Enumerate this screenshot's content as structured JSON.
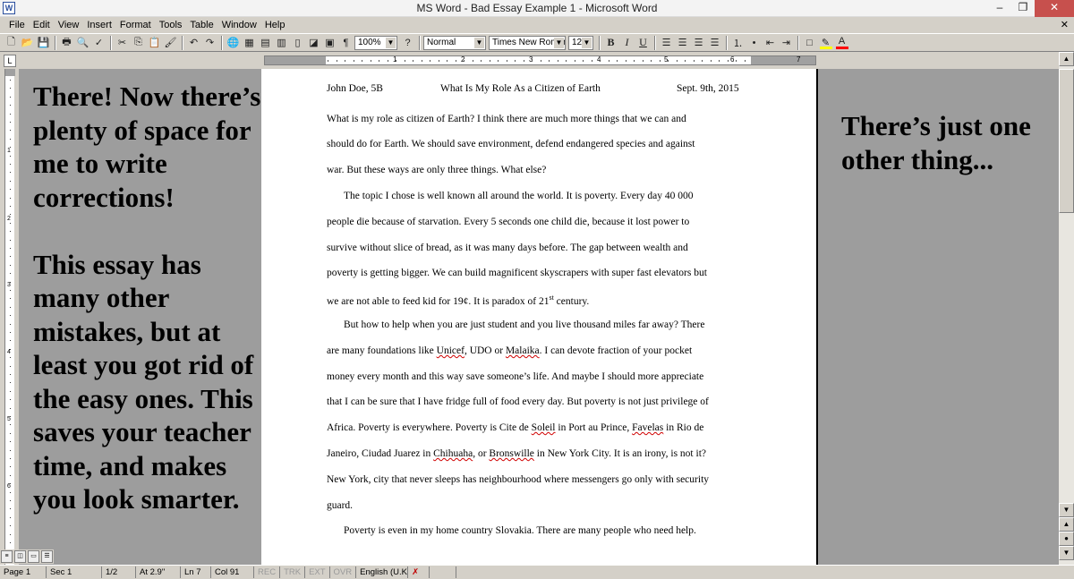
{
  "window": {
    "title": "MS Word - Bad Essay Example 1 - Microsoft Word",
    "app_icon": "W",
    "controls": [
      "–",
      "❐",
      "✕"
    ]
  },
  "menu": {
    "items": [
      "File",
      "Edit",
      "View",
      "Insert",
      "Format",
      "Tools",
      "Table",
      "Window",
      "Help"
    ],
    "doc_close": "✕"
  },
  "toolbar": {
    "zoom": "100%",
    "style": "Normal",
    "font": "Times New Roman",
    "size": "12",
    "bold": "B",
    "italic": "I",
    "underline": "U",
    "highlight_color": "#ffff00",
    "font_color": "#ff0000"
  },
  "ruler": {
    "numbers": [
      "1",
      "2",
      "3",
      "4",
      "5",
      "6",
      "7"
    ],
    "vertical_numbers": [
      "1",
      "2",
      "3",
      "4",
      "5",
      "6"
    ]
  },
  "document": {
    "header": {
      "author": "John Doe, 5B",
      "title": "What Is My Role As a Citizen of Earth",
      "date": "Sept. 9th, 2015"
    },
    "lines": [
      "What is my role as citizen of Earth? I think there are much more things that we can and",
      "should do for Earth. We should save environment, defend endangered species and against",
      "war. But these ways are only three things. What else?",
      "The topic I chose is well known all around the world. It is poverty. Every day 40 000",
      "people die because of starvation. Every 5 seconds one child die, because it lost power to",
      "survive without slice of bread, as it was many days before.  The gap between wealth and",
      "poverty is getting bigger. We can build magnificent skyscrapers with super fast elevators but",
      "we are not able to feed kid for 19¢. It is paradox of 21",
      "But how to help when you are just student and you live thousand miles far away? There",
      "are many foundations like ",
      "money every month and this way save someone’s life. And maybe I should more appreciate",
      "that I can be sure that I have fridge full of food every day.  But poverty is not just privilege of",
      "Africa. Poverty is everywhere.  Poverty is Cite de ",
      "Janeiro, Ciudad Juarez in ",
      "New York, city that never sleeps has neighbourhood where messengers go only with security",
      "guard.",
      "Poverty is even in my home country Slovakia. There are many people who need help."
    ],
    "line8_sup": "st",
    "line8_tail": " century.",
    "line10_unicef": "Unicef",
    "line10_mid": ", UDO or ",
    "line10_malaika": "Malaika",
    "line10_tail": ". I can devote fraction of your pocket",
    "line13_soleil": "Soleil",
    "line13_mid": " in Port au Prince, ",
    "line13_favelas": "Favelas",
    "line13_tail": " in Rio de",
    "line14_chihuaha": "Chihuaha",
    "line14_mid": ", or ",
    "line14_bronswille": "Bronswille",
    "line14_tail": " in New York City. It is an irony, is not it?"
  },
  "notes": {
    "left_p1": "There! Now there’s plenty of space for me to write corrections!",
    "left_p2": "This essay has many other mistakes, but at least you got rid of the easy ones. This saves your teacher time, and makes you look smarter.",
    "right": "There’s just one other thing..."
  },
  "status": {
    "page": "Page 1",
    "sec": "Sec 1",
    "pages": "1/2",
    "at": "At 2.9\"",
    "ln": "Ln 7",
    "col": "Col 91",
    "rec": "REC",
    "trk": "TRK",
    "ext": "EXT",
    "ovr": "OVR",
    "lang": "English (U.K"
  }
}
